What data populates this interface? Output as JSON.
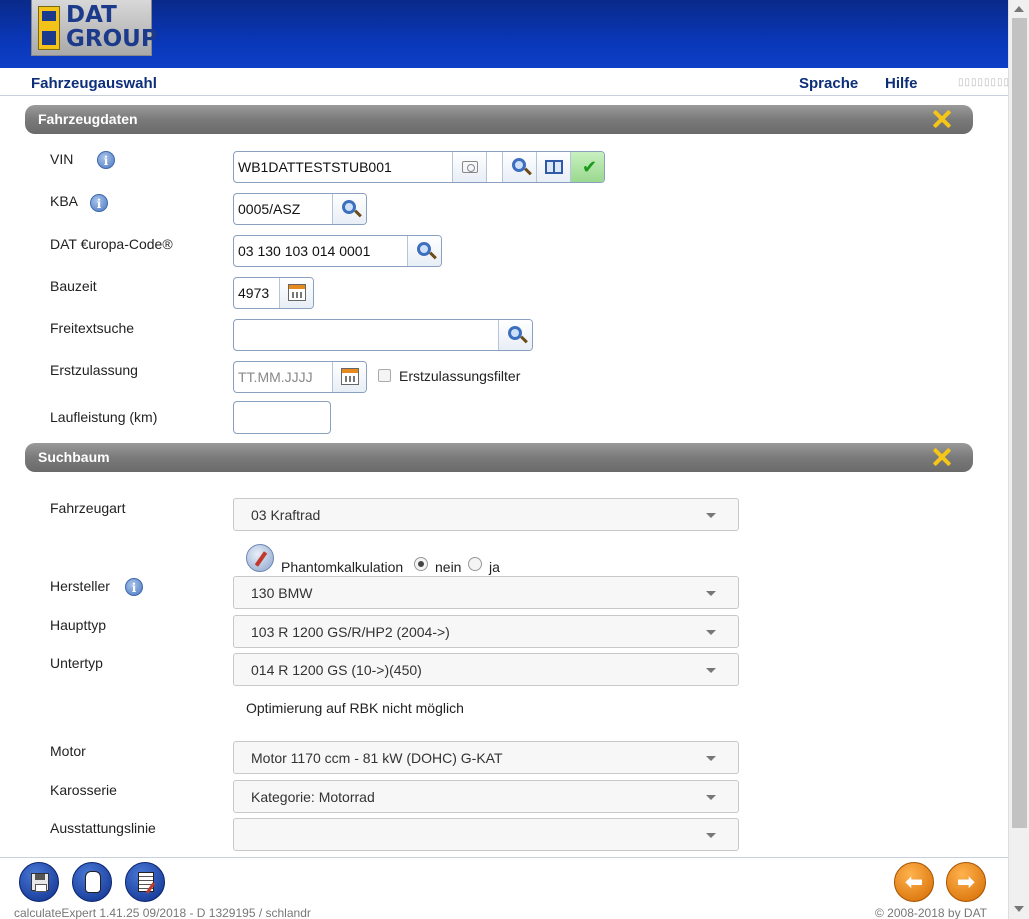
{
  "header": {
    "logo_text_line1": "DAT",
    "logo_text_line2": "GROUP",
    "logo_mark_text": "DAT"
  },
  "nav": {
    "title": "Fahrzeugauswahl",
    "language": "Sprache",
    "help": "Hilfe"
  },
  "vehicle_section": {
    "title": "Fahrzeugdaten",
    "vin": {
      "label": "VIN",
      "value": "WB1DATTESTSTUB001"
    },
    "kba": {
      "label": "KBA",
      "value": "0005/ASZ"
    },
    "europa_code": {
      "label": "DAT €uropa-Code®",
      "value": "03 130 103 014 0001"
    },
    "bauzeit": {
      "label": "Bauzeit",
      "value": "4973"
    },
    "freitext": {
      "label": "Freitextsuche",
      "value": ""
    },
    "erstzulassung": {
      "label": "Erstzulassung",
      "placeholder": "TT.MM.JJJJ",
      "filter_label": "Erstzulassungsfilter"
    },
    "laufleistung": {
      "label": "Laufleistung (km)",
      "value": ""
    }
  },
  "search_tree": {
    "title": "Suchbaum",
    "fahrzeugart": {
      "label": "Fahrzeugart",
      "value": "03 Kraftrad"
    },
    "phantom": {
      "label": "Phantomkalkulation",
      "no": "nein",
      "yes": "ja",
      "selected": "nein"
    },
    "hersteller": {
      "label": "Hersteller",
      "value": "130 BMW"
    },
    "haupttyp": {
      "label": "Haupttyp",
      "value": "103 R 1200 GS/R/HP2 (2004->)"
    },
    "untertyp": {
      "label": "Untertyp",
      "value": "014 R 1200 GS (10->)(450)"
    },
    "notice": "Optimierung auf RBK nicht möglich",
    "motor": {
      "label": "Motor",
      "value": "Motor 1170 ccm - 81 kW (DOHC) G-KAT"
    },
    "karosserie": {
      "label": "Karosserie",
      "value": "Kategorie: Motorrad"
    },
    "ausstattung": {
      "label": "Ausstattungslinie",
      "value": ""
    }
  },
  "footer": {
    "status": "calculateExpert   1.41.25   09/2018 - D   1329195 / schlandr",
    "copyright": "© 2008-2018 by DAT"
  },
  "colors": {
    "header_blue": "#0a37b8",
    "nav_text": "#0d2f7a",
    "section_gray": "#7a7a7a",
    "close_yellow": "#f5c518",
    "nav_orange": "#e07a10"
  }
}
